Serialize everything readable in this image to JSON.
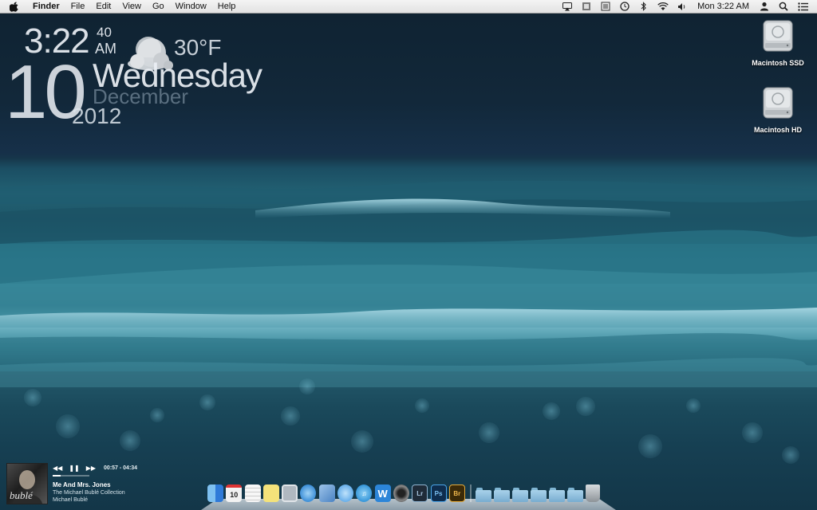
{
  "menubar": {
    "app_name": "Finder",
    "menus": [
      "File",
      "Edit",
      "View",
      "Go",
      "Window",
      "Help"
    ],
    "clock": "Mon 3:22 AM",
    "status_icons": [
      "airplay-icon",
      "battery-icon",
      "menu-extra-icon",
      "time-machine-icon",
      "bluetooth-icon",
      "wifi-icon",
      "volume-icon",
      "user-icon",
      "spotlight-icon",
      "notification-center-icon"
    ]
  },
  "clock_widget": {
    "time": "3:22",
    "seconds": "40",
    "ampm": "AM",
    "temperature": "30°F",
    "weather_icon": "cloud-moon-icon",
    "day": "10",
    "weekday": "Wednesday",
    "month": "December",
    "year": "2012"
  },
  "drives": [
    {
      "label": "Macintosh SSD",
      "icon": "hard-drive-icon"
    },
    {
      "label": "Macintosh HD",
      "icon": "hard-drive-icon"
    }
  ],
  "now_playing": {
    "art_text": "bublé",
    "time": "00:57 - 04:34",
    "title": "Me And Mrs. Jones",
    "album": "The Michael Bublé Collection",
    "artist": "Michael Bublé",
    "progress": 0.21
  },
  "dock": {
    "calendar_day": "10",
    "apps": [
      {
        "name": "finder",
        "label": "",
        "color": "#3b8de0"
      },
      {
        "name": "calendar",
        "label": "10",
        "color": "#f2f2f2"
      },
      {
        "name": "reminders",
        "label": "",
        "color": "#f7f7f7"
      },
      {
        "name": "stickies",
        "label": "",
        "color": "#f4e27a"
      },
      {
        "name": "preview",
        "label": "",
        "color": "#b0b8c0"
      },
      {
        "name": "safari",
        "label": "",
        "color": "#3d8fd8"
      },
      {
        "name": "mail",
        "label": "",
        "color": "#6a9bd0"
      },
      {
        "name": "messages",
        "label": "",
        "color": "#5aa7e8"
      },
      {
        "name": "itunes",
        "label": "",
        "color": "#3aa0e0"
      },
      {
        "name": "wunderlist",
        "label": "W",
        "color": "#2c85d8"
      },
      {
        "name": "aperture",
        "label": "",
        "color": "#444"
      },
      {
        "name": "lightroom",
        "label": "Lr",
        "color": "#1f2b38"
      },
      {
        "name": "photoshop",
        "label": "Ps",
        "color": "#0e2d4e"
      },
      {
        "name": "bridge",
        "label": "Br",
        "color": "#3b2a08"
      }
    ],
    "folders": 6
  }
}
